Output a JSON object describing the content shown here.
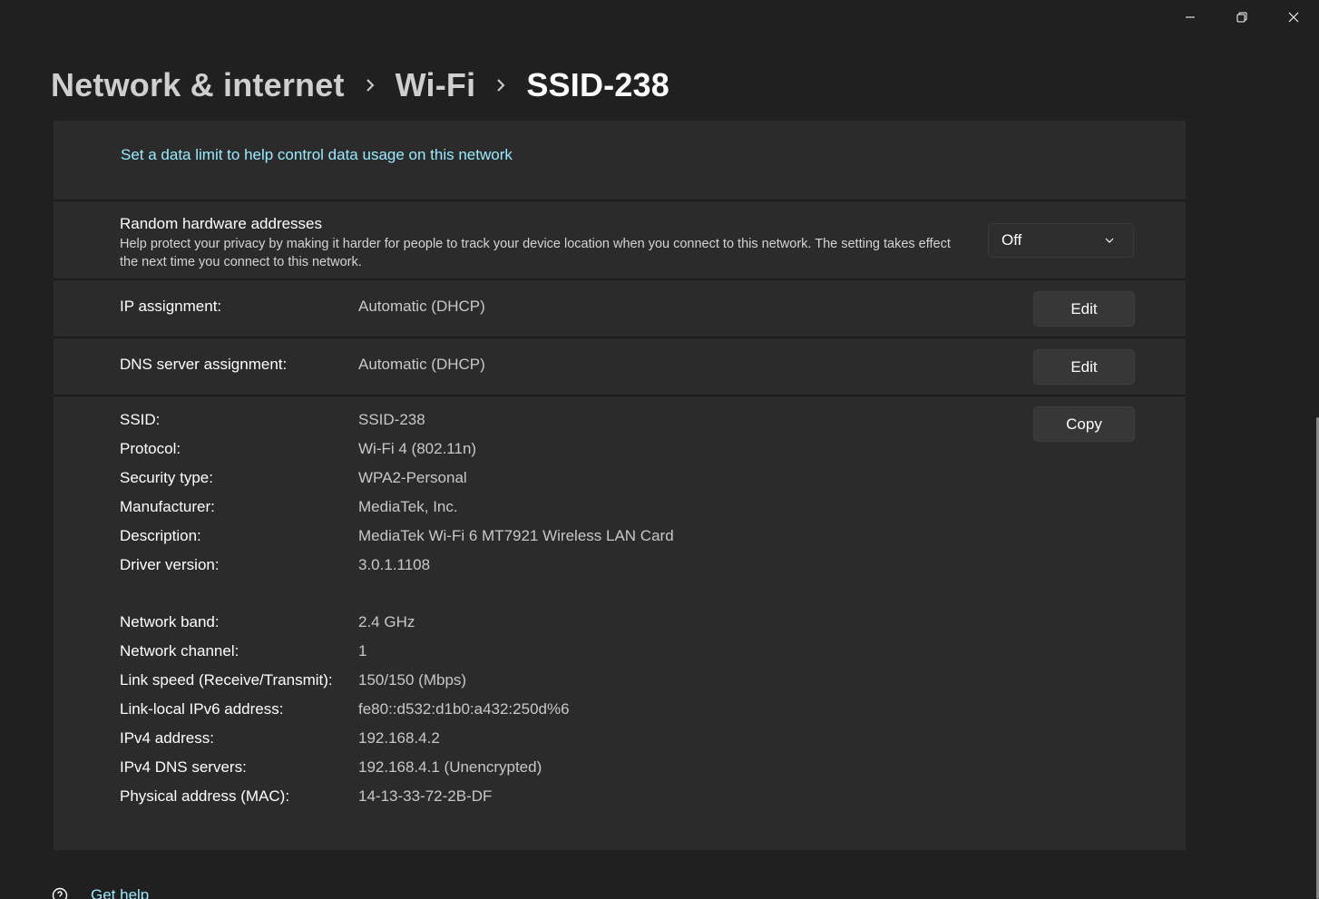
{
  "window": {
    "caption": {
      "minimize_icon": "minimize-icon",
      "maximize_icon": "restore-icon",
      "close_icon": "close-icon"
    }
  },
  "breadcrumb": {
    "items": [
      "Network & internet",
      "Wi-Fi",
      "SSID-238"
    ],
    "separator_icon": "chevron-right-icon"
  },
  "data_limit": {
    "link_text": "Set a data limit to help control data usage on this network"
  },
  "random_hw": {
    "title": "Random hardware addresses",
    "description": "Help protect your privacy by making it harder for people to track your device location when you connect to this network. The setting takes effect the next time you connect to this network.",
    "selected": "Off"
  },
  "ip_assignment": {
    "label": "IP assignment:",
    "value": "Automatic (DHCP)",
    "button": "Edit"
  },
  "dns_assignment": {
    "label": "DNS server assignment:",
    "value": "Automatic (DHCP)",
    "button": "Edit"
  },
  "properties": {
    "copy_button": "Copy",
    "group1": [
      {
        "key": "SSID:",
        "value": "SSID-238"
      },
      {
        "key": "Protocol:",
        "value": "Wi-Fi 4 (802.11n)"
      },
      {
        "key": "Security type:",
        "value": "WPA2-Personal"
      },
      {
        "key": "Manufacturer:",
        "value": "MediaTek, Inc."
      },
      {
        "key": "Description:",
        "value": "MediaTek Wi-Fi 6 MT7921 Wireless LAN Card"
      },
      {
        "key": "Driver version:",
        "value": "3.0.1.1108"
      }
    ],
    "group2": [
      {
        "key": "Network band:",
        "value": "2.4 GHz"
      },
      {
        "key": "Network channel:",
        "value": "1"
      },
      {
        "key": "Link speed (Receive/Transmit):",
        "value": "150/150 (Mbps)"
      },
      {
        "key": "Link-local IPv6 address:",
        "value": "fe80::d532:d1b0:a432:250d%6"
      },
      {
        "key": "IPv4 address:",
        "value": "192.168.4.2"
      },
      {
        "key": "IPv4 DNS servers:",
        "value": "192.168.4.1 (Unencrypted)"
      },
      {
        "key": "Physical address (MAC):",
        "value": "14-13-33-72-2B-DF"
      }
    ]
  },
  "help": {
    "label": "Get help",
    "icon": "help-icon"
  },
  "colors": {
    "background": "#202020",
    "card": "#2b2b2b",
    "link": "#99ebff"
  }
}
